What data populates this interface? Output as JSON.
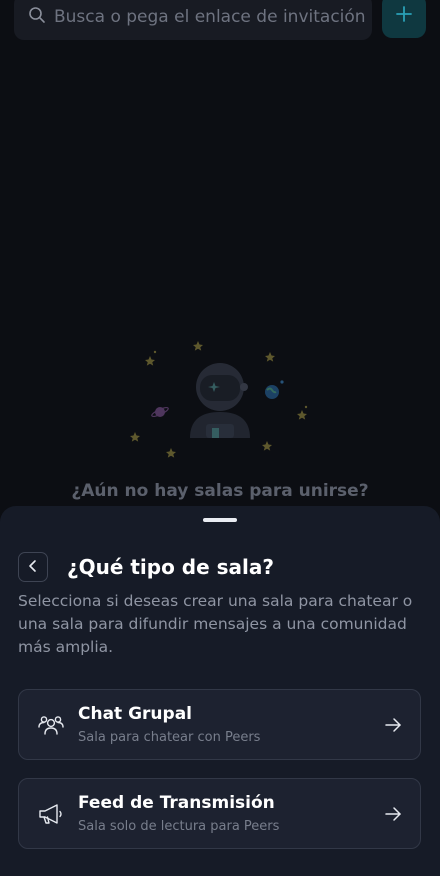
{
  "search": {
    "placeholder": "Busca o pega el enlace de invitación p"
  },
  "add_button": {
    "icon": "plus-icon"
  },
  "empty_state": {
    "title": "¿Aún no hay salas para unirse?",
    "illustration": "astronaut-icon"
  },
  "sheet": {
    "title": "¿Qué tipo de sala?",
    "description": "Selecciona si deseas crear una sala para chatear o una sala para difundir mensajes a una comunidad más amplia.",
    "back_icon": "chevron-left-icon",
    "options": [
      {
        "title": "Chat Grupal",
        "subtitle": "Sala para chatear con Peers",
        "icon": "users-icon"
      },
      {
        "title": "Feed de Transmisión",
        "subtitle": "Sala solo de lectura para Peers",
        "icon": "megaphone-icon"
      }
    ]
  },
  "colors": {
    "background": "#0c0e13",
    "sheet": "#161b27",
    "card": "#1d2230",
    "accent": "#2aa0b6"
  }
}
